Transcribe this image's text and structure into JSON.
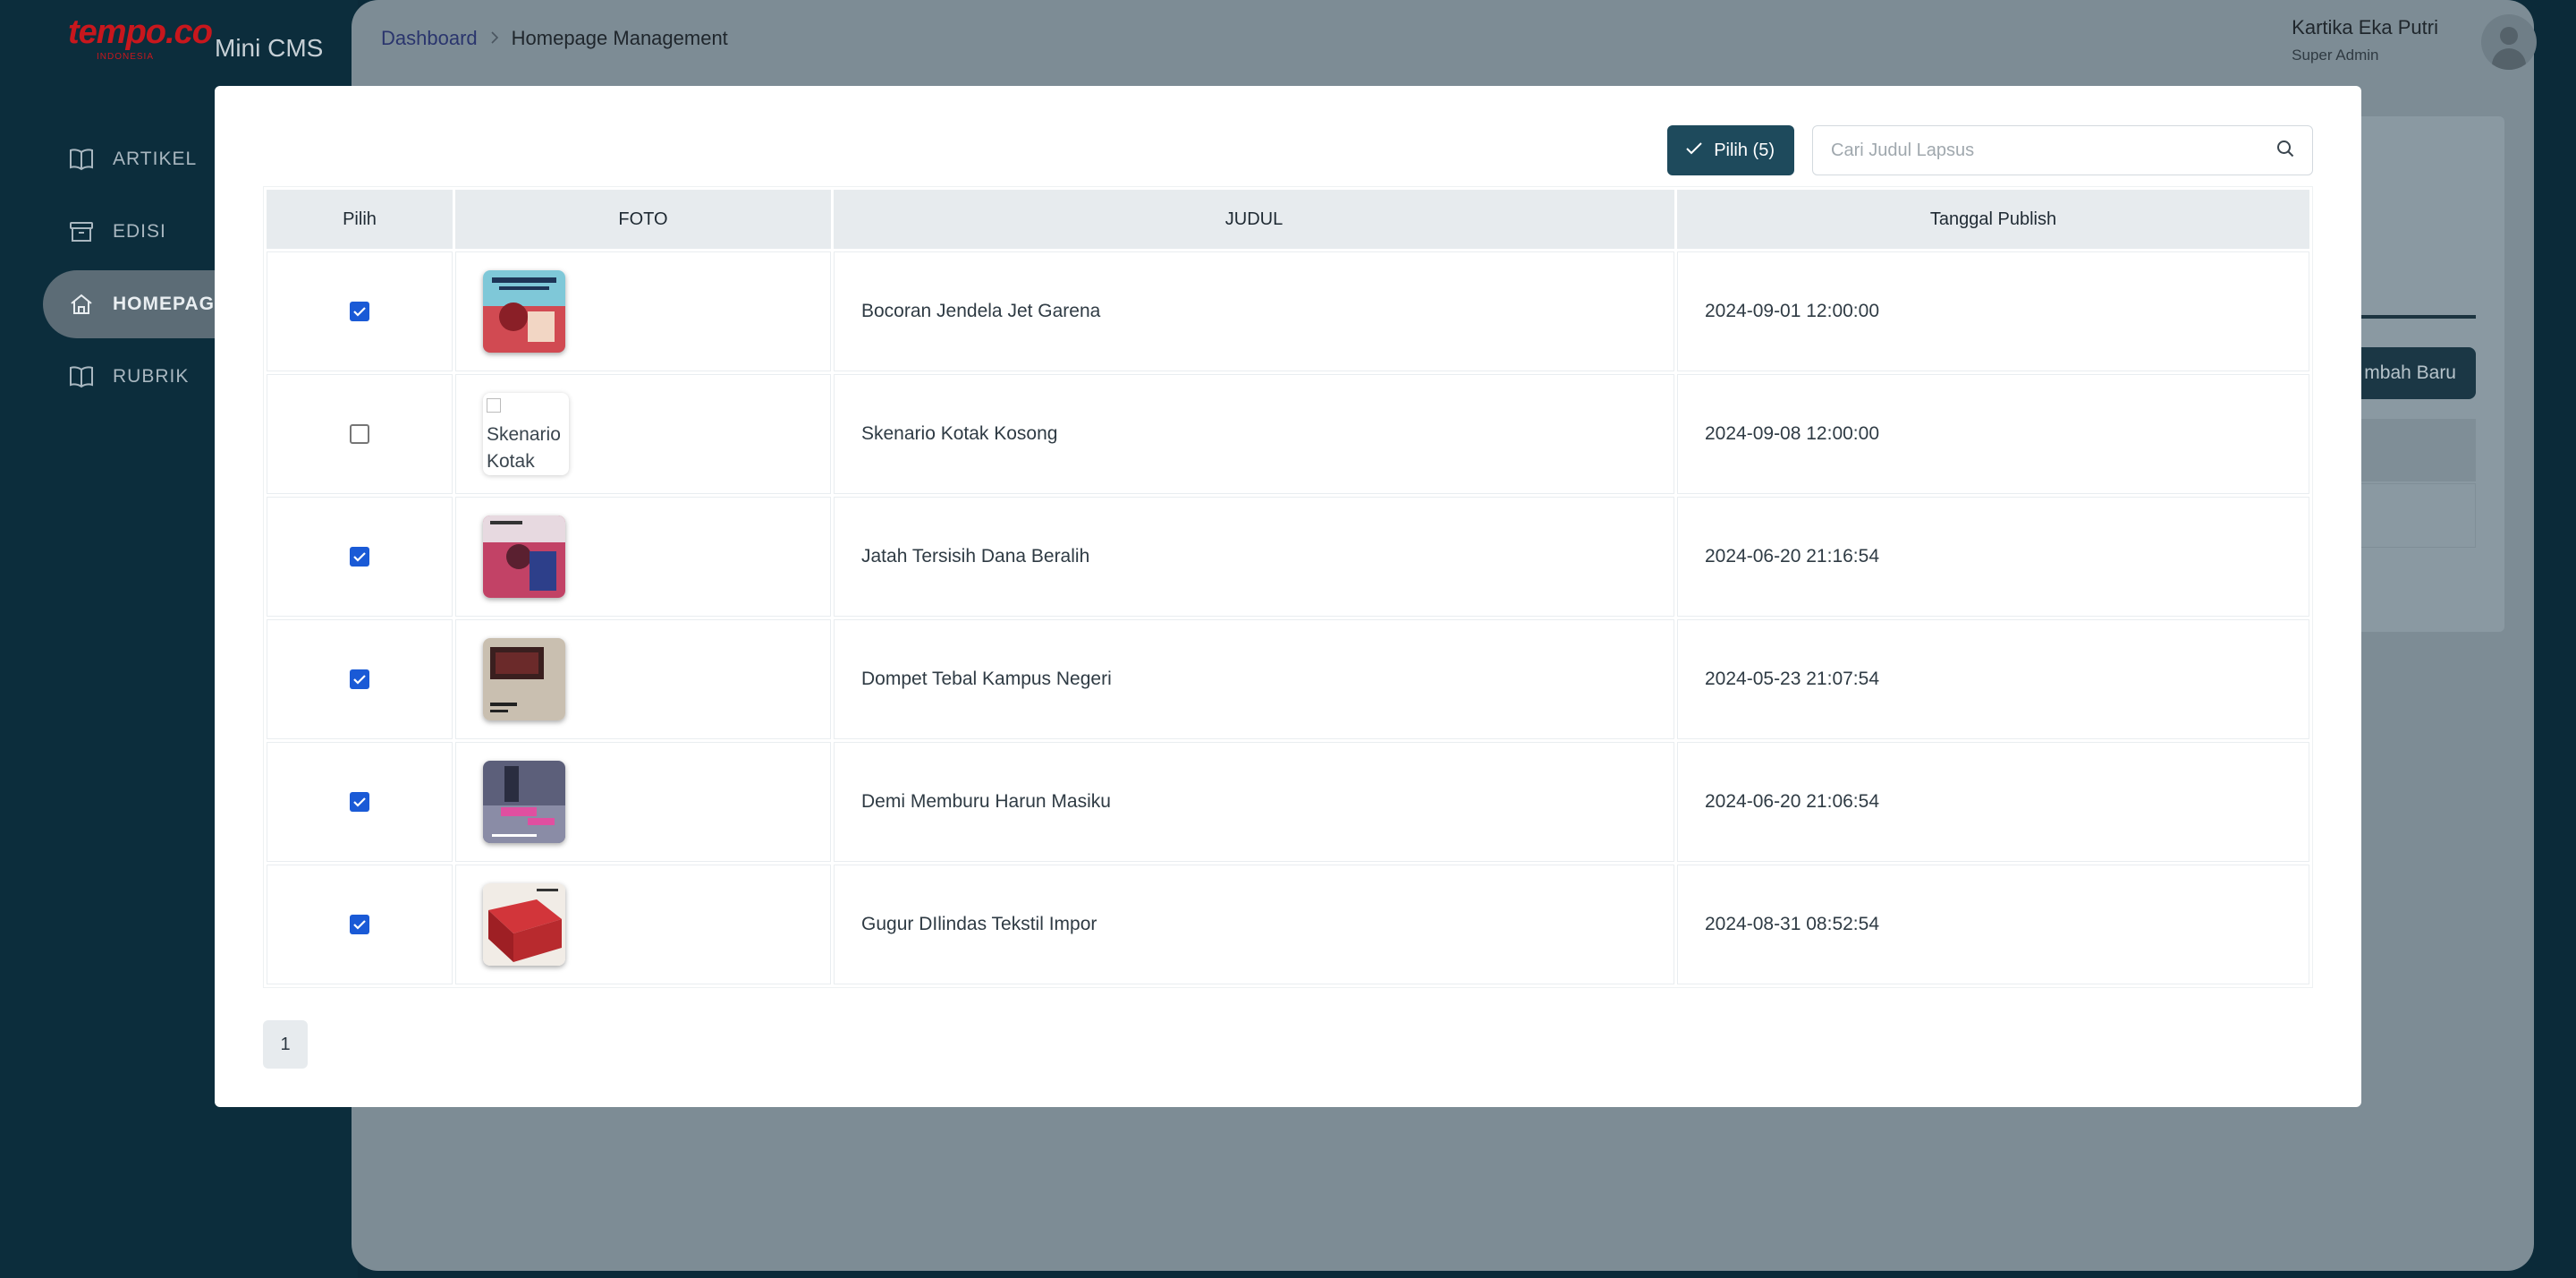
{
  "app": {
    "logo_text": "tempo.co",
    "logo_sub": "INDONESIA",
    "name": "Mini CMS"
  },
  "sidebar": {
    "items": [
      {
        "label": "ARTIKEL",
        "icon": "book-open-icon",
        "active": false
      },
      {
        "label": "EDISI",
        "icon": "archive-box-icon",
        "active": false
      },
      {
        "label": "HOMEPAGE",
        "icon": "home-icon",
        "active": true
      },
      {
        "label": "RUBRIK",
        "icon": "book-open-icon",
        "active": false
      }
    ]
  },
  "header": {
    "breadcrumb": {
      "link": "Dashboard",
      "separator": ">",
      "current": "Homepage Management"
    },
    "user": {
      "name": "Kartika Eka Putri",
      "role": "Super Admin"
    }
  },
  "background": {
    "add_button_label": "mbah Baru"
  },
  "modal": {
    "pilih_button_label": "Pilih (5)",
    "search_placeholder": "Cari Judul Lapsus",
    "columns": [
      "Pilih",
      "FOTO",
      "JUDUL",
      "Tanggal Publish"
    ],
    "rows": [
      {
        "checked": true,
        "judul": "Bocoran Jendela Jet Garena",
        "tanggal": "2024-09-01 12:00:00",
        "image_broken": false,
        "thumb_color": "#d14a52"
      },
      {
        "checked": false,
        "judul": "Skenario Kotak Kosong",
        "tanggal": "2024-09-08 12:00:00",
        "image_broken": true,
        "alt_text": "Skenario Kotak"
      },
      {
        "checked": true,
        "judul": "Jatah Tersisih Dana Beralih",
        "tanggal": "2024-06-20 21:16:54",
        "image_broken": false,
        "thumb_color": "#c24266"
      },
      {
        "checked": true,
        "judul": "Dompet Tebal Kampus Negeri",
        "tanggal": "2024-05-23 21:07:54",
        "image_broken": false,
        "thumb_color": "#c9bfb0"
      },
      {
        "checked": true,
        "judul": "Demi Memburu Harun Masiku",
        "tanggal": "2024-06-20 21:06:54",
        "image_broken": false,
        "thumb_color": "#5c5f7a"
      },
      {
        "checked": true,
        "judul": "Gugur DIlindas Tekstil Impor",
        "tanggal": "2024-08-31 08:52:54",
        "image_broken": false,
        "thumb_color": "#b82a2e"
      }
    ],
    "pagination": {
      "current_page": "1"
    }
  },
  "colors": {
    "brand_red": "#c8171d",
    "primary_button": "#1e4a5c",
    "checkbox_checked": "#1a5ad6",
    "sidebar_bg": "#0c2d3c"
  }
}
